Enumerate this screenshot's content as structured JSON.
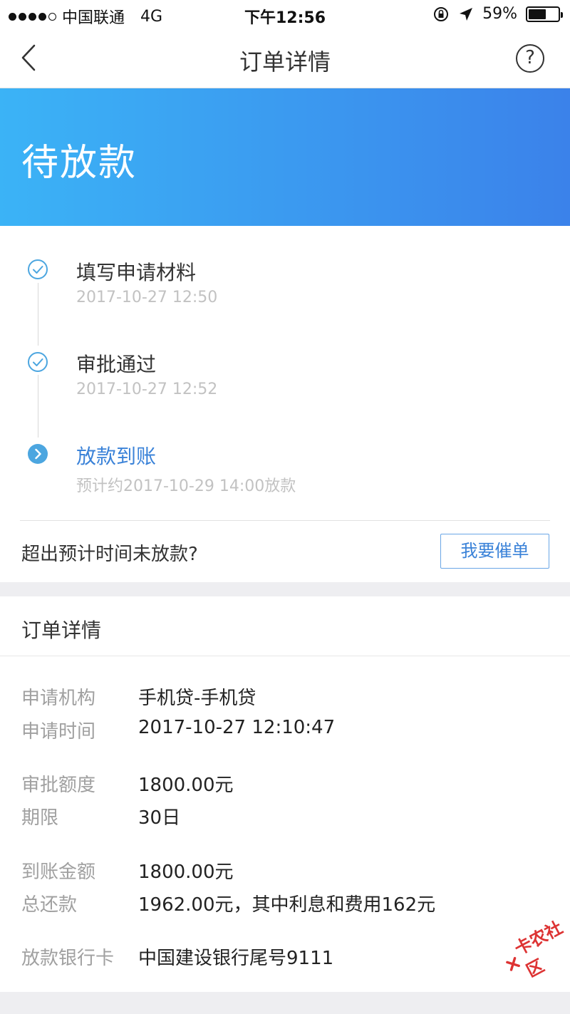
{
  "status_bar": {
    "carrier": "中国联通",
    "network": "4G",
    "time": "下午12:56",
    "battery": "59%",
    "battery_level": 0.59
  },
  "nav": {
    "title": "订单详情",
    "back_icon": "chevron-left-icon",
    "help_icon": "question-circle-icon",
    "help_glyph": "?"
  },
  "banner": {
    "status": "待放款",
    "gradient": [
      "#3bb3f6",
      "#3b82ea"
    ]
  },
  "timeline": {
    "steps": [
      {
        "title": "填写申请材料",
        "subtitle": "2017-10-27 12:50",
        "state": "done",
        "icon": "check-circle-icon"
      },
      {
        "title": "审批通过",
        "subtitle": "2017-10-27 12:52",
        "state": "done",
        "icon": "check-circle-icon"
      },
      {
        "title": "放款到账",
        "subtitle": "预计约2017-10-29 14:00放款",
        "state": "current",
        "icon": "chevron-right-circle-icon"
      }
    ]
  },
  "urge": {
    "label": "超出预计时间未放款?",
    "button": "我要催单"
  },
  "details": {
    "title": "订单详情",
    "rows": [
      {
        "label": "申请机构",
        "value": "手机贷-手机贷"
      },
      {
        "label": "申请时间",
        "value": "2017-10-27 12:10:47"
      },
      {
        "label": "审批额度",
        "value": "1800.00元"
      },
      {
        "label": "期限",
        "value": "30日"
      },
      {
        "label": "到账金额",
        "value": "1800.00元"
      },
      {
        "label": "总还款",
        "value": "1962.00元，其中利息和费用162元"
      },
      {
        "label": "放款银行卡",
        "value": "中国建设银行尾号9111"
      }
    ]
  },
  "watermark": {
    "text": "卡农社区"
  },
  "colors": {
    "accent": "#3a82d8",
    "icon_blue": "#4ca6e0",
    "muted_text": "#c2c2c2",
    "label_text": "#a0a0a0",
    "watermark_red": "#dd3333"
  }
}
